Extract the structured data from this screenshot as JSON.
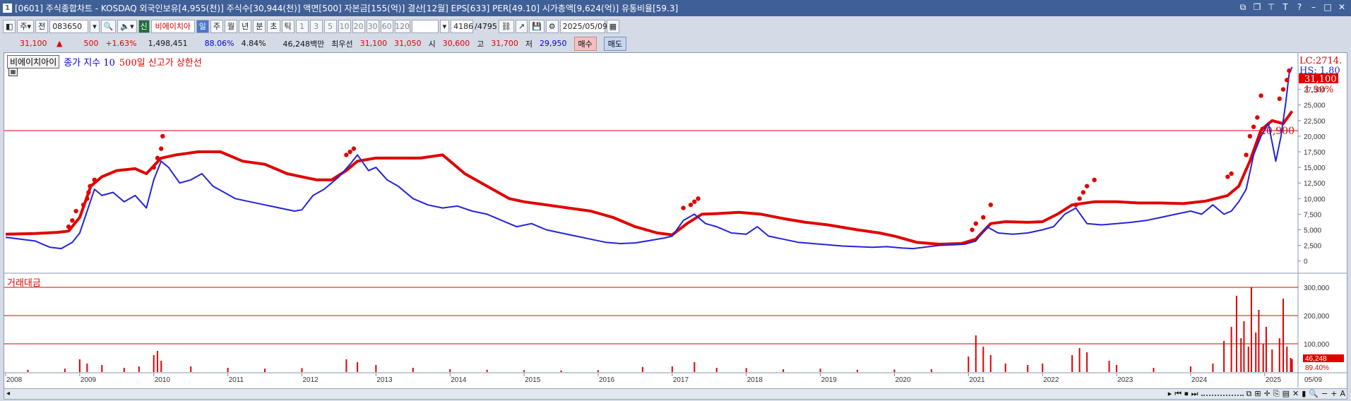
{
  "titlebar": {
    "window_number": "1",
    "text": "[0601] 주식종합차트 - KOSDAQ 외국인보유[4,955(천)] 주식수[30,944(천)] 액면[500] 자본금[155(억)] 결산[12월] EPS[633] PER[49.10] 시가총액[9,624(억)] 유통비율[59.3]"
  },
  "toolbar": {
    "type_label": "주",
    "all_label": "전",
    "code_value": "083650",
    "shin_label": "신",
    "stock_name": "비에이치아",
    "periods": [
      "일",
      "주",
      "월",
      "년",
      "분",
      "초",
      "틱"
    ],
    "active_period": "일",
    "intervals": [
      "1",
      "3",
      "5",
      "10",
      "20",
      "30",
      "60",
      "120"
    ],
    "count": "4186",
    "total": "/4795",
    "date_value": "2025/05/09"
  },
  "infobar": {
    "price": "31,100",
    "change": "500",
    "change_pct": "+1.63%",
    "volume": "1,498,451",
    "vol_ratio": "88.06%",
    "turnover": "4.84%",
    "amount": "46,248백만",
    "best_label": "최우선",
    "best_ask": "31,100",
    "best_bid": "31,050",
    "open_label": "시",
    "open": "30,600",
    "high_label": "고",
    "high": "31,700",
    "low_label": "저",
    "low": "29,950",
    "buy_label": "매수",
    "sell_label": "매도"
  },
  "legend": {
    "stock_name": "비에이치아이",
    "indicator1": "종가 지수 10",
    "indicator2": "500일 신고가 상한선"
  },
  "volume_panel": {
    "label": "거래대금",
    "last_value": "46,248",
    "last_ratio": "89.40%"
  },
  "price_labels": {
    "lc": "LC:2714.",
    "hs": "HS: 1.80",
    "current": "31,100",
    "current_pct": "1.30%",
    "hline": "20,900"
  },
  "colors": {
    "close_line": "#2323d6",
    "high_line": "#e00000",
    "signal_dot": "#e00000",
    "volume_bar": "#e00000",
    "hline": "#d00000"
  },
  "chart_data": [
    {
      "type": "line",
      "title": "",
      "x_tick_labels": [
        "2008",
        "2009",
        "2010",
        "2011",
        "2012",
        "2013",
        "2014",
        "2015",
        "2016",
        "2017",
        "2018",
        "2019",
        "2020",
        "2021",
        "2022",
        "2023",
        "2024",
        "2025",
        "05/09"
      ],
      "y_ticks": [
        0,
        2500,
        5000,
        7500,
        10000,
        12500,
        15000,
        17500,
        20000,
        22500,
        25000,
        27500
      ],
      "y_tick_labels": [
        "0",
        "2,500",
        "5,000",
        "7,500",
        "10,000",
        "12,500",
        "15,000",
        "17,500",
        "20,000",
        "22,500",
        "25,000",
        "27,500"
      ],
      "ylim": [
        -1500,
        33000
      ],
      "xlim": [
        2008.0,
        2025.45
      ],
      "hline": 20900,
      "series": [
        {
          "name": "종가 지수 10",
          "x": [
            2008.0,
            2008.2,
            2008.4,
            2008.6,
            2008.75,
            2008.9,
            2009.0,
            2009.1,
            2009.2,
            2009.3,
            2009.45,
            2009.6,
            2009.75,
            2009.9,
            2010.0,
            2010.1,
            2010.2,
            2010.35,
            2010.5,
            2010.65,
            2010.8,
            2010.95,
            2011.1,
            2011.3,
            2011.5,
            2011.7,
            2011.9,
            2012.0,
            2012.15,
            2012.3,
            2012.5,
            2012.65,
            2012.75,
            2012.9,
            2013.0,
            2013.15,
            2013.3,
            2013.5,
            2013.7,
            2013.9,
            2014.1,
            2014.3,
            2014.5,
            2014.7,
            2014.9,
            2015.1,
            2015.3,
            2015.5,
            2015.7,
            2015.9,
            2016.1,
            2016.3,
            2016.5,
            2016.7,
            2016.9,
            2017.0,
            2017.15,
            2017.3,
            2017.45,
            2017.6,
            2017.8,
            2018.0,
            2018.15,
            2018.3,
            2018.5,
            2018.7,
            2018.9,
            2019.1,
            2019.3,
            2019.5,
            2019.7,
            2019.9,
            2020.1,
            2020.25,
            2020.4,
            2020.6,
            2020.8,
            2020.95,
            2021.1,
            2021.25,
            2021.4,
            2021.6,
            2021.8,
            2022.0,
            2022.15,
            2022.3,
            2022.45,
            2022.6,
            2022.8,
            2023.0,
            2023.2,
            2023.4,
            2023.6,
            2023.8,
            2024.0,
            2024.15,
            2024.3,
            2024.45,
            2024.55,
            2024.65,
            2024.75,
            2024.85,
            2024.95,
            2025.05,
            2025.15,
            2025.22,
            2025.28,
            2025.33,
            2025.37
          ],
          "y": [
            3800,
            3500,
            3200,
            2200,
            2000,
            3000,
            4500,
            8000,
            11500,
            10500,
            11000,
            9500,
            10500,
            8500,
            13000,
            16000,
            15000,
            12500,
            13000,
            14000,
            12000,
            11000,
            10000,
            9500,
            9000,
            8500,
            8000,
            8200,
            10500,
            11500,
            13500,
            15500,
            17000,
            14500,
            15000,
            13000,
            12000,
            10000,
            9000,
            8500,
            8800,
            8000,
            7500,
            6500,
            5500,
            6000,
            5000,
            4500,
            4000,
            3500,
            3000,
            2800,
            2900,
            3300,
            3700,
            4000,
            6500,
            7500,
            6000,
            5500,
            4500,
            4300,
            5500,
            4000,
            3500,
            3000,
            2800,
            2600,
            2400,
            2300,
            2200,
            2300,
            2100,
            2000,
            2200,
            2500,
            2600,
            2700,
            3200,
            5500,
            4500,
            4300,
            4500,
            5000,
            5500,
            7500,
            8500,
            6000,
            5800,
            6000,
            6200,
            6500,
            7000,
            7500,
            8000,
            7500,
            9000,
            7500,
            8000,
            9500,
            11500,
            17000,
            20000,
            22000,
            16000,
            20000,
            25000,
            30000,
            31100
          ]
        },
        {
          "name": "500일 신고가 상한선",
          "x": [
            2008.0,
            2008.4,
            2008.7,
            2008.85,
            2009.0,
            2009.15,
            2009.3,
            2009.5,
            2009.75,
            2009.9,
            2010.1,
            2010.3,
            2010.6,
            2010.9,
            2011.2,
            2011.5,
            2011.8,
            2012.0,
            2012.2,
            2012.4,
            2012.6,
            2012.75,
            2013.0,
            2013.3,
            2013.6,
            2013.9,
            2014.2,
            2014.5,
            2014.8,
            2015.0,
            2015.3,
            2015.6,
            2015.9,
            2016.2,
            2016.5,
            2016.8,
            2017.0,
            2017.2,
            2017.4,
            2017.6,
            2017.9,
            2018.2,
            2018.5,
            2018.8,
            2019.1,
            2019.5,
            2019.8,
            2020.0,
            2020.3,
            2020.6,
            2020.9,
            2021.1,
            2021.3,
            2021.5,
            2021.8,
            2022.0,
            2022.2,
            2022.4,
            2022.7,
            2023.0,
            2023.3,
            2023.6,
            2023.9,
            2024.2,
            2024.5,
            2024.65,
            2024.8,
            2024.95,
            2025.1,
            2025.25,
            2025.37
          ],
          "y": [
            4300,
            4400,
            4600,
            4800,
            7000,
            12000,
            13500,
            14500,
            14800,
            14000,
            16500,
            17000,
            17500,
            17500,
            16000,
            15500,
            14000,
            13500,
            13000,
            13000,
            14500,
            16000,
            16500,
            16500,
            16500,
            17000,
            14000,
            12000,
            10000,
            9500,
            9000,
            8500,
            8000,
            7000,
            5500,
            4500,
            4200,
            6000,
            7500,
            7600,
            7800,
            7500,
            6800,
            6200,
            5800,
            5000,
            4500,
            4000,
            3000,
            2700,
            2800,
            3500,
            6000,
            6300,
            6200,
            6300,
            7500,
            9000,
            9500,
            9500,
            9300,
            9300,
            9200,
            9600,
            10500,
            12000,
            16000,
            21000,
            22500,
            22000,
            24000
          ]
        }
      ],
      "signal_markers": {
        "name": "500일 신고가 상한선",
        "x": [
          2008.85,
          2008.9,
          2008.95,
          2009.05,
          2009.1,
          2009.12,
          2009.14,
          2009.2,
          2010.0,
          2010.05,
          2010.1,
          2010.12,
          2012.6,
          2012.65,
          2012.7,
          2017.15,
          2017.25,
          2017.3,
          2017.35,
          2021.05,
          2021.1,
          2021.2,
          2021.3,
          2022.45,
          2022.5,
          2022.55,
          2022.6,
          2022.7,
          2024.5,
          2024.55,
          2024.75,
          2024.8,
          2024.85,
          2024.9,
          2024.95,
          2025.2,
          2025.25,
          2025.3,
          2025.33
        ],
        "y": [
          5500,
          6500,
          8000,
          9000,
          10000,
          11000,
          12000,
          13000,
          15000,
          16500,
          18000,
          20000,
          17000,
          17500,
          18000,
          8500,
          9000,
          9500,
          10000,
          5000,
          6000,
          7000,
          9000,
          9000,
          10000,
          11000,
          12000,
          13000,
          13500,
          14000,
          17000,
          20000,
          21500,
          23000,
          26500,
          26000,
          27500,
          29000,
          30500
        ]
      }
    },
    {
      "type": "bar",
      "title": "거래대금",
      "y_ticks": [
        100000,
        200000,
        300000
      ],
      "y_tick_labels": [
        "100,000",
        "200,000",
        "300,000"
      ],
      "ylim": [
        0,
        330000
      ],
      "series": [
        {
          "name": "거래대금",
          "x": [
            2008.3,
            2008.8,
            2009.0,
            2009.1,
            2009.3,
            2009.6,
            2009.8,
            2010.0,
            2010.05,
            2010.1,
            2010.5,
            2011.0,
            2011.5,
            2012.0,
            2012.6,
            2012.75,
            2013.0,
            2013.5,
            2014.0,
            2014.5,
            2015.0,
            2015.5,
            2016.0,
            2016.6,
            2017.0,
            2017.3,
            2017.6,
            2018.0,
            2018.5,
            2019.0,
            2019.5,
            2020.0,
            2020.5,
            2021.0,
            2021.1,
            2021.2,
            2021.3,
            2021.5,
            2021.8,
            2022.0,
            2022.4,
            2022.5,
            2022.6,
            2022.9,
            2023.0,
            2023.5,
            2024.0,
            2024.3,
            2024.45,
            2024.55,
            2024.62,
            2024.68,
            2024.72,
            2024.78,
            2024.82,
            2024.88,
            2024.92,
            2024.98,
            2025.02,
            2025.1,
            2025.2,
            2025.25,
            2025.3,
            2025.35,
            2025.37
          ],
          "y": [
            8000,
            12000,
            45000,
            30000,
            25000,
            15000,
            20000,
            60000,
            75000,
            40000,
            20000,
            15000,
            12000,
            14000,
            45000,
            35000,
            25000,
            15000,
            10000,
            8000,
            7000,
            6000,
            6500,
            18000,
            20000,
            35000,
            15000,
            14000,
            10000,
            12000,
            8000,
            9000,
            10000,
            55000,
            130000,
            90000,
            60000,
            30000,
            25000,
            30000,
            60000,
            85000,
            70000,
            40000,
            25000,
            15000,
            20000,
            30000,
            110000,
            160000,
            270000,
            120000,
            180000,
            90000,
            300000,
            140000,
            220000,
            100000,
            160000,
            80000,
            120000,
            260000,
            90000,
            50000,
            46248
          ]
        }
      ]
    }
  ]
}
